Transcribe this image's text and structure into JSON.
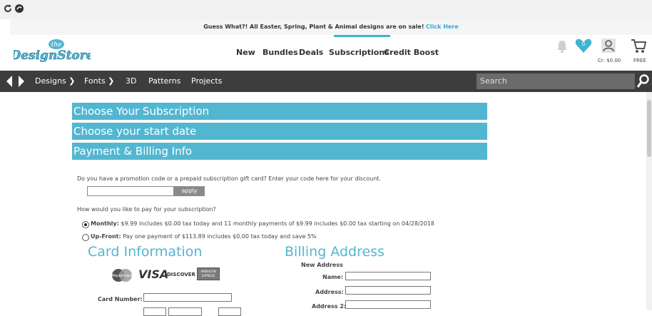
{
  "announcement": {
    "text": "Guess What?! All Easter, Spring, Plant & Animal designs are on sale!",
    "link": "Click Here"
  },
  "header": {
    "logo_small": "the",
    "logo_main": "DesignStore",
    "nav": [
      "New",
      "Bundles",
      "Deals",
      "Subscriptions",
      "Credit Boost"
    ],
    "cart_badge": "0",
    "credit": "Cr: $0.00",
    "free_label": "FREE"
  },
  "mainnav": {
    "items": [
      "Designs ❯",
      "Fonts ❯",
      "3D",
      "Patterns",
      "Projects"
    ],
    "search_placeholder": "Search"
  },
  "accordion": [
    "Choose Your Subscription",
    "Choose your start date",
    "Payment & Billing Info"
  ],
  "promo": {
    "question": "Do you have a promotion code or a prepaid subscription gift card? Enter your code here for your discount.",
    "apply_label": "apply"
  },
  "pay": {
    "question": "How would you like to pay for your subscription?",
    "monthly_label": "Monthly:",
    "monthly_text": "$9.99 includes $0.00 tax today and 11  monthly payments of $9.99 includes $0.00 tax  starting on 04/28/2018",
    "upfront_label": "Up-Front:",
    "upfront_text": "Pay one payment of $113.89 includes $0.00 tax  today and save 5%"
  },
  "card": {
    "heading": "Card Information",
    "card_number_label": "Card Number:",
    "brands": [
      "MasterCard",
      "VISA",
      "DISCOVER",
      "AMERICAN EXPRESS"
    ]
  },
  "billing": {
    "heading": "Billing Address",
    "new_address": "New Address",
    "name_label": "Name:",
    "address_label": "Address:",
    "address2_label": "Address 2:"
  },
  "colors": {
    "accent": "#53b6d1",
    "nav_dark": "#3d3d3d",
    "heart": "#3fb4cf"
  }
}
